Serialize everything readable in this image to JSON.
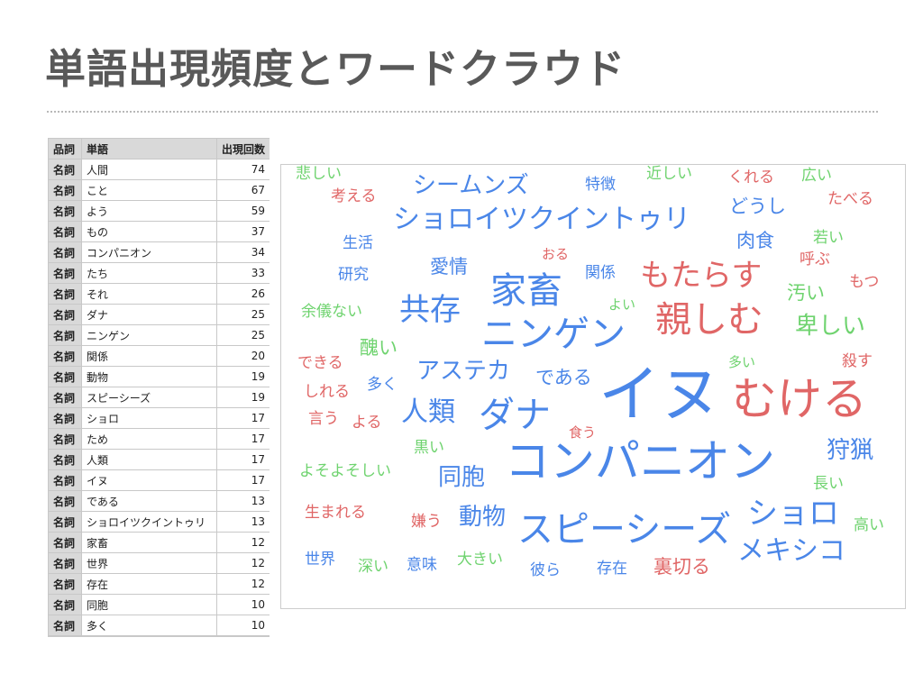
{
  "slide": {
    "title": "単語出現頻度とワードクラウド"
  },
  "table": {
    "headers": {
      "pos": "品詞",
      "word": "単語",
      "count": "出現回数"
    },
    "rows": [
      {
        "pos": "名詞",
        "word": "人間",
        "count": "74"
      },
      {
        "pos": "名詞",
        "word": "こと",
        "count": "67"
      },
      {
        "pos": "名詞",
        "word": "よう",
        "count": "59"
      },
      {
        "pos": "名詞",
        "word": "もの",
        "count": "37"
      },
      {
        "pos": "名詞",
        "word": "コンパニオン",
        "count": "34"
      },
      {
        "pos": "名詞",
        "word": "たち",
        "count": "33"
      },
      {
        "pos": "名詞",
        "word": "それ",
        "count": "26"
      },
      {
        "pos": "名詞",
        "word": "ダナ",
        "count": "25"
      },
      {
        "pos": "名詞",
        "word": "ニンゲン",
        "count": "25"
      },
      {
        "pos": "名詞",
        "word": "関係",
        "count": "20"
      },
      {
        "pos": "名詞",
        "word": "動物",
        "count": "19"
      },
      {
        "pos": "名詞",
        "word": "スピーシーズ",
        "count": "19"
      },
      {
        "pos": "名詞",
        "word": "ショロ",
        "count": "17"
      },
      {
        "pos": "名詞",
        "word": "ため",
        "count": "17"
      },
      {
        "pos": "名詞",
        "word": "人類",
        "count": "17"
      },
      {
        "pos": "名詞",
        "word": "イヌ",
        "count": "17"
      },
      {
        "pos": "名詞",
        "word": "である",
        "count": "13"
      },
      {
        "pos": "名詞",
        "word": "ショロイツクイントゥリ",
        "count": "13"
      },
      {
        "pos": "名詞",
        "word": "家畜",
        "count": "12"
      },
      {
        "pos": "名詞",
        "word": "世界",
        "count": "12"
      },
      {
        "pos": "名詞",
        "word": "存在",
        "count": "12"
      },
      {
        "pos": "名詞",
        "word": "同胞",
        "count": "10"
      },
      {
        "pos": "名詞",
        "word": "多く",
        "count": "10"
      },
      {
        "pos": "",
        "word": "",
        "count": ""
      }
    ]
  },
  "cloud": {
    "colors": {
      "blue": "#4a86e8",
      "red": "#e06666",
      "green": "#6fd36f"
    },
    "words": [
      {
        "text": "イヌ",
        "color": "blue",
        "size": "huge"
      },
      {
        "text": "コンパニオン",
        "color": "blue",
        "size": "xl"
      },
      {
        "text": "むける",
        "color": "red",
        "size": "xl"
      },
      {
        "text": "親しむ",
        "color": "red",
        "size": "l"
      },
      {
        "text": "ニンゲン",
        "color": "blue",
        "size": "l"
      },
      {
        "text": "ダナ",
        "color": "blue",
        "size": "l"
      },
      {
        "text": "スピーシーズ",
        "color": "blue",
        "size": "l"
      },
      {
        "text": "家畜",
        "color": "blue",
        "size": "l"
      },
      {
        "text": "もたらす",
        "color": "red",
        "size": "ml"
      },
      {
        "text": "共存",
        "color": "blue",
        "size": "ml"
      },
      {
        "text": "ショロイツクイントゥリ",
        "color": "blue",
        "size": "m"
      },
      {
        "text": "ショロ",
        "color": "blue",
        "size": "ml"
      },
      {
        "text": "メキシコ",
        "color": "blue",
        "size": "m"
      },
      {
        "text": "人類",
        "color": "blue",
        "size": "m"
      },
      {
        "text": "同胞",
        "color": "blue",
        "size": "ms"
      },
      {
        "text": "狩猟",
        "color": "blue",
        "size": "ms"
      },
      {
        "text": "シームンズ",
        "color": "blue",
        "size": "ms"
      },
      {
        "text": "アステカ",
        "color": "blue",
        "size": "ms"
      },
      {
        "text": "動物",
        "color": "blue",
        "size": "ms"
      },
      {
        "text": "卑しい",
        "color": "green",
        "size": "ms"
      },
      {
        "text": "である",
        "color": "blue",
        "size": "s"
      },
      {
        "text": "愛情",
        "color": "blue",
        "size": "s"
      },
      {
        "text": "肉食",
        "color": "blue",
        "size": "s"
      },
      {
        "text": "どうし",
        "color": "blue",
        "size": "s"
      },
      {
        "text": "汚い",
        "color": "green",
        "size": "s"
      },
      {
        "text": "醜い",
        "color": "green",
        "size": "s"
      },
      {
        "text": "余儀ない",
        "color": "green",
        "size": "xs"
      },
      {
        "text": "裏切る",
        "color": "red",
        "size": "s"
      },
      {
        "text": "生まれる",
        "color": "red",
        "size": "xs"
      },
      {
        "text": "近しい",
        "color": "green",
        "size": "xs"
      },
      {
        "text": "悲しい",
        "color": "green",
        "size": "xs"
      },
      {
        "text": "考える",
        "color": "red",
        "size": "xs"
      },
      {
        "text": "特徴",
        "color": "blue",
        "size": "xs"
      },
      {
        "text": "くれる",
        "color": "red",
        "size": "xs"
      },
      {
        "text": "広い",
        "color": "green",
        "size": "xs"
      },
      {
        "text": "たべる",
        "color": "red",
        "size": "xs"
      },
      {
        "text": "生活",
        "color": "blue",
        "size": "xs"
      },
      {
        "text": "若い",
        "color": "green",
        "size": "xs"
      },
      {
        "text": "呼ぶ",
        "color": "red",
        "size": "xs"
      },
      {
        "text": "おる",
        "color": "red",
        "size": "xxs"
      },
      {
        "text": "研究",
        "color": "blue",
        "size": "xs"
      },
      {
        "text": "関係",
        "color": "blue",
        "size": "xs"
      },
      {
        "text": "もつ",
        "color": "red",
        "size": "xs"
      },
      {
        "text": "よい",
        "color": "green",
        "size": "xxs"
      },
      {
        "text": "できる",
        "color": "red",
        "size": "xs"
      },
      {
        "text": "多い",
        "color": "green",
        "size": "xxs"
      },
      {
        "text": "殺す",
        "color": "red",
        "size": "xs"
      },
      {
        "text": "しれる",
        "color": "red",
        "size": "xs"
      },
      {
        "text": "多く",
        "color": "blue",
        "size": "xs"
      },
      {
        "text": "言う",
        "color": "red",
        "size": "xs"
      },
      {
        "text": "よる",
        "color": "red",
        "size": "xs"
      },
      {
        "text": "食う",
        "color": "red",
        "size": "xxs"
      },
      {
        "text": "黒い",
        "color": "green",
        "size": "xs"
      },
      {
        "text": "よそよそしい",
        "color": "green",
        "size": "xs"
      },
      {
        "text": "長い",
        "color": "green",
        "size": "xs"
      },
      {
        "text": "嫌う",
        "color": "red",
        "size": "xs"
      },
      {
        "text": "高い",
        "color": "green",
        "size": "xs"
      },
      {
        "text": "世界",
        "color": "blue",
        "size": "xs"
      },
      {
        "text": "深い",
        "color": "green",
        "size": "xs"
      },
      {
        "text": "意味",
        "color": "blue",
        "size": "xs"
      },
      {
        "text": "大きい",
        "color": "green",
        "size": "xs"
      },
      {
        "text": "彼ら",
        "color": "blue",
        "size": "xs"
      },
      {
        "text": "存在",
        "color": "blue",
        "size": "xs"
      }
    ]
  }
}
